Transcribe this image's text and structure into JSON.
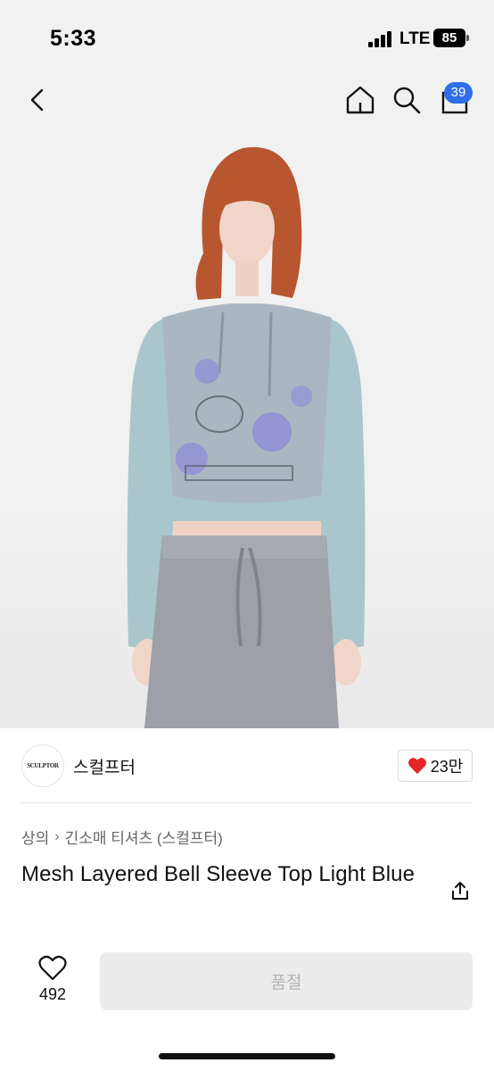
{
  "status_bar": {
    "time": "5:33",
    "network": "LTE",
    "battery": "85"
  },
  "nav": {
    "cart_count": "39",
    "icons": [
      "back-arrow-icon",
      "home-icon",
      "search-icon",
      "shopping-bag-icon"
    ]
  },
  "product_image": {
    "description_icon": "model-photo"
  },
  "seller": {
    "logo_text": "SCULPTOR",
    "name": "스컬프터",
    "favorite_count": "23만",
    "heart_color": "#e5252a"
  },
  "breadcrumb": {
    "category": "상의",
    "subcategory": "긴소매 티셔츠 (스컬프터)"
  },
  "product": {
    "title": "Mesh Layered Bell Sleeve Top Light Blue"
  },
  "actions": {
    "like_count": "492",
    "soldout_label": "품절"
  },
  "colors": {
    "accent": "#2f6ee8",
    "disabled_bg": "#ececec",
    "disabled_text": "#b3b3b3"
  }
}
